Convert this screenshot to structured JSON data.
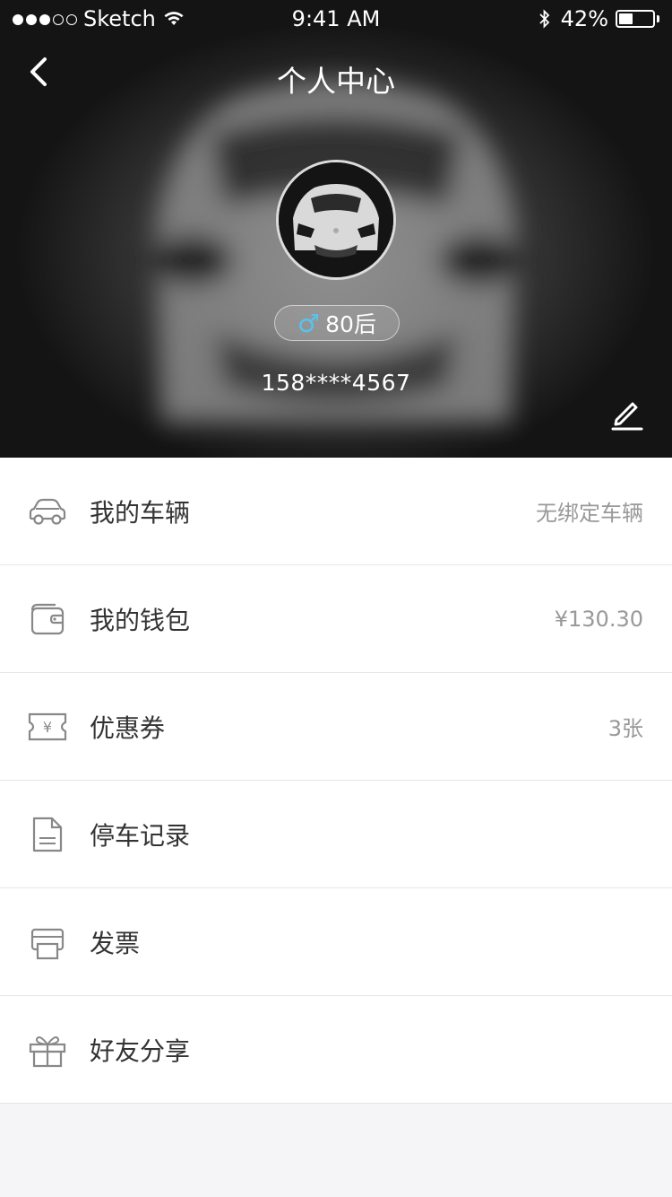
{
  "status_bar": {
    "carrier": "Sketch",
    "time": "9:41 AM",
    "battery": "42%",
    "battery_level": 0.42,
    "signal_icons": [
      "signal-dots-icon",
      "wifi-icon",
      "bluetooth-icon",
      "battery-icon"
    ]
  },
  "header": {
    "title": "个人中心",
    "back_icon": "chevron-left-icon",
    "edit_icon": "pencil-icon"
  },
  "profile": {
    "tag": "80后",
    "gender_symbol": "♂",
    "phone": "158****4567"
  },
  "menu": {
    "items": [
      {
        "label": "我的车辆",
        "value": "无绑定车辆",
        "icon": "car-icon"
      },
      {
        "label": "我的钱包",
        "value": "¥130.30",
        "icon": "wallet-icon"
      },
      {
        "label": "优惠券",
        "value": "3张",
        "icon": "coupon-icon"
      },
      {
        "label": "停车记录",
        "value": "",
        "icon": "document-icon"
      },
      {
        "label": "发票",
        "value": "",
        "icon": "printer-icon"
      },
      {
        "label": "好友分享",
        "value": "",
        "icon": "gift-icon"
      }
    ]
  },
  "colors": {
    "accent_male": "#56c4f0",
    "text_primary": "#333333",
    "text_secondary": "#999999",
    "background": "#f5f5f7"
  }
}
